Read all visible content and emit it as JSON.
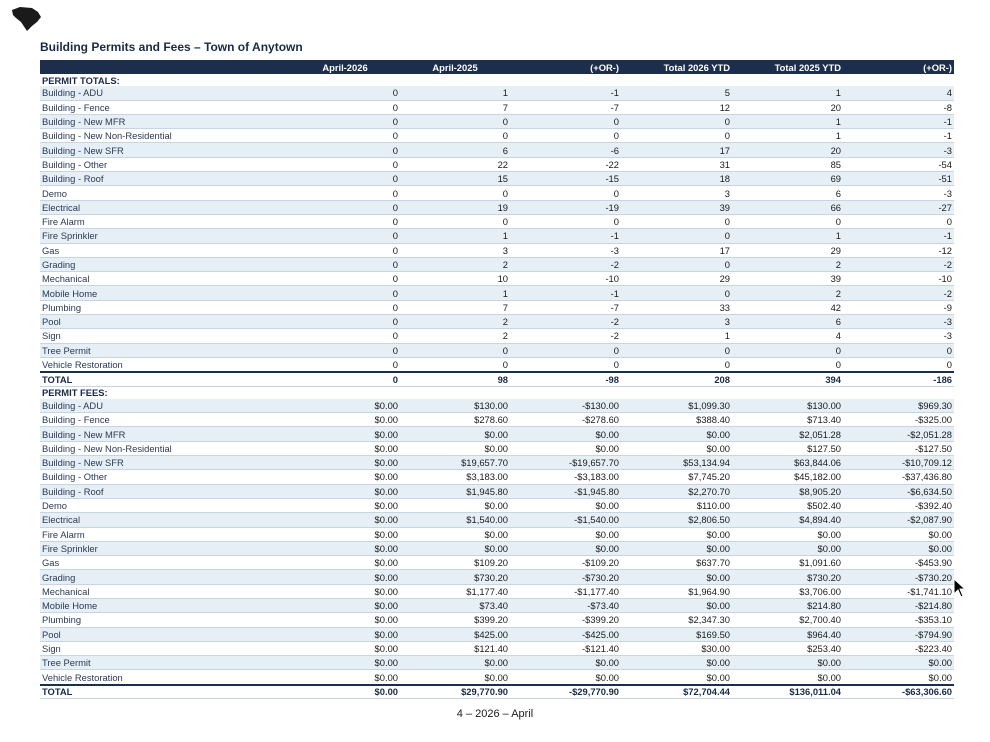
{
  "title": "Building Permits and Fees – Town of Anytown",
  "columns": [
    "",
    "April-2026",
    "April-2025",
    "(+OR-)",
    "Total 2026 YTD",
    "Total 2025 YTD",
    "(+OR-)"
  ],
  "permit_totals": {
    "section_label": "PERMIT TOTALS:",
    "rows": [
      {
        "label": "Building - ADU",
        "v": [
          "0",
          "1",
          "-1",
          "5",
          "1",
          "4"
        ]
      },
      {
        "label": "Building - Fence",
        "v": [
          "0",
          "7",
          "-7",
          "12",
          "20",
          "-8"
        ]
      },
      {
        "label": "Building - New MFR",
        "v": [
          "0",
          "0",
          "0",
          "0",
          "1",
          "-1"
        ]
      },
      {
        "label": "Building - New Non-Residential",
        "v": [
          "0",
          "0",
          "0",
          "0",
          "1",
          "-1"
        ]
      },
      {
        "label": "Building - New SFR",
        "v": [
          "0",
          "6",
          "-6",
          "17",
          "20",
          "-3"
        ]
      },
      {
        "label": "Building - Other",
        "v": [
          "0",
          "22",
          "-22",
          "31",
          "85",
          "-54"
        ]
      },
      {
        "label": "Building - Roof",
        "v": [
          "0",
          "15",
          "-15",
          "18",
          "69",
          "-51"
        ]
      },
      {
        "label": "Demo",
        "v": [
          "0",
          "0",
          "0",
          "3",
          "6",
          "-3"
        ]
      },
      {
        "label": "Electrical",
        "v": [
          "0",
          "19",
          "-19",
          "39",
          "66",
          "-27"
        ]
      },
      {
        "label": "Fire Alarm",
        "v": [
          "0",
          "0",
          "0",
          "0",
          "0",
          "0"
        ]
      },
      {
        "label": "Fire Sprinkler",
        "v": [
          "0",
          "1",
          "-1",
          "0",
          "1",
          "-1"
        ]
      },
      {
        "label": "Gas",
        "v": [
          "0",
          "3",
          "-3",
          "17",
          "29",
          "-12"
        ]
      },
      {
        "label": "Grading",
        "v": [
          "0",
          "2",
          "-2",
          "0",
          "2",
          "-2"
        ]
      },
      {
        "label": "Mechanical",
        "v": [
          "0",
          "10",
          "-10",
          "29",
          "39",
          "-10"
        ]
      },
      {
        "label": "Mobile Home",
        "v": [
          "0",
          "1",
          "-1",
          "0",
          "2",
          "-2"
        ]
      },
      {
        "label": "Plumbing",
        "v": [
          "0",
          "7",
          "-7",
          "33",
          "42",
          "-9"
        ]
      },
      {
        "label": "Pool",
        "v": [
          "0",
          "2",
          "-2",
          "3",
          "6",
          "-3"
        ]
      },
      {
        "label": "Sign",
        "v": [
          "0",
          "2",
          "-2",
          "1",
          "4",
          "-3"
        ]
      },
      {
        "label": "Tree Permit",
        "v": [
          "0",
          "0",
          "0",
          "0",
          "0",
          "0"
        ]
      },
      {
        "label": "Vehicle Restoration",
        "v": [
          "0",
          "0",
          "0",
          "0",
          "0",
          "0"
        ]
      }
    ],
    "total": {
      "label": "TOTAL",
      "v": [
        "0",
        "98",
        "-98",
        "208",
        "394",
        "-186"
      ]
    }
  },
  "permit_fees": {
    "section_label": "PERMIT FEES:",
    "rows": [
      {
        "label": "Building - ADU",
        "v": [
          "$0.00",
          "$130.00",
          "-$130.00",
          "$1,099.30",
          "$130.00",
          "$969.30"
        ]
      },
      {
        "label": "Building - Fence",
        "v": [
          "$0.00",
          "$278.60",
          "-$278.60",
          "$388.40",
          "$713.40",
          "-$325.00"
        ]
      },
      {
        "label": "Building - New MFR",
        "v": [
          "$0.00",
          "$0.00",
          "$0.00",
          "$0.00",
          "$2,051.28",
          "-$2,051.28"
        ]
      },
      {
        "label": "Building - New Non-Residential",
        "v": [
          "$0.00",
          "$0.00",
          "$0.00",
          "$0.00",
          "$127.50",
          "-$127.50"
        ]
      },
      {
        "label": "Building - New SFR",
        "v": [
          "$0.00",
          "$19,657.70",
          "-$19,657.70",
          "$53,134.94",
          "$63,844.06",
          "-$10,709.12"
        ]
      },
      {
        "label": "Building - Other",
        "v": [
          "$0.00",
          "$3,183.00",
          "-$3,183.00",
          "$7,745.20",
          "$45,182.00",
          "-$37,436.80"
        ]
      },
      {
        "label": "Building - Roof",
        "v": [
          "$0.00",
          "$1,945.80",
          "-$1,945.80",
          "$2,270.70",
          "$8,905.20",
          "-$6,634.50"
        ]
      },
      {
        "label": "Demo",
        "v": [
          "$0.00",
          "$0.00",
          "$0.00",
          "$110.00",
          "$502.40",
          "-$392.40"
        ]
      },
      {
        "label": "Electrical",
        "v": [
          "$0.00",
          "$1,540.00",
          "-$1,540.00",
          "$2,806.50",
          "$4,894.40",
          "-$2,087.90"
        ]
      },
      {
        "label": "Fire Alarm",
        "v": [
          "$0.00",
          "$0.00",
          "$0.00",
          "$0.00",
          "$0.00",
          "$0.00"
        ]
      },
      {
        "label": "Fire Sprinkler",
        "v": [
          "$0.00",
          "$0.00",
          "$0.00",
          "$0.00",
          "$0.00",
          "$0.00"
        ]
      },
      {
        "label": "Gas",
        "v": [
          "$0.00",
          "$109.20",
          "-$109.20",
          "$637.70",
          "$1,091.60",
          "-$453.90"
        ]
      },
      {
        "label": "Grading",
        "v": [
          "$0.00",
          "$730.20",
          "-$730.20",
          "$0.00",
          "$730.20",
          "-$730.20"
        ]
      },
      {
        "label": "Mechanical",
        "v": [
          "$0.00",
          "$1,177.40",
          "-$1,177.40",
          "$1,964.90",
          "$3,706.00",
          "-$1,741.10"
        ]
      },
      {
        "label": "Mobile Home",
        "v": [
          "$0.00",
          "$73.40",
          "-$73.40",
          "$0.00",
          "$214.80",
          "-$214.80"
        ]
      },
      {
        "label": "Plumbing",
        "v": [
          "$0.00",
          "$399.20",
          "-$399.20",
          "$2,347.30",
          "$2,700.40",
          "-$353.10"
        ]
      },
      {
        "label": "Pool",
        "v": [
          "$0.00",
          "$425.00",
          "-$425.00",
          "$169.50",
          "$964.40",
          "-$794.90"
        ]
      },
      {
        "label": "Sign",
        "v": [
          "$0.00",
          "$121.40",
          "-$121.40",
          "$30.00",
          "$253.40",
          "-$223.40"
        ]
      },
      {
        "label": "Tree Permit",
        "v": [
          "$0.00",
          "$0.00",
          "$0.00",
          "$0.00",
          "$0.00",
          "$0.00"
        ]
      },
      {
        "label": "Vehicle Restoration",
        "v": [
          "$0.00",
          "$0.00",
          "$0.00",
          "$0.00",
          "$0.00",
          "$0.00"
        ]
      }
    ],
    "total": {
      "label": "TOTAL",
      "v": [
        "$0.00",
        "$29,770.90",
        "-$29,770.90",
        "$72,704.44",
        "$136,011.04",
        "-$63,306.60"
      ]
    }
  },
  "footer": "4 – 2026 – April",
  "icons": {
    "logo": "state-silhouette-icon",
    "cursor": "mouse-pointer-icon"
  },
  "colors": {
    "header_bg": "#1c2e4c",
    "alt_row": "#e6eff6",
    "title": "#1a2a48"
  }
}
